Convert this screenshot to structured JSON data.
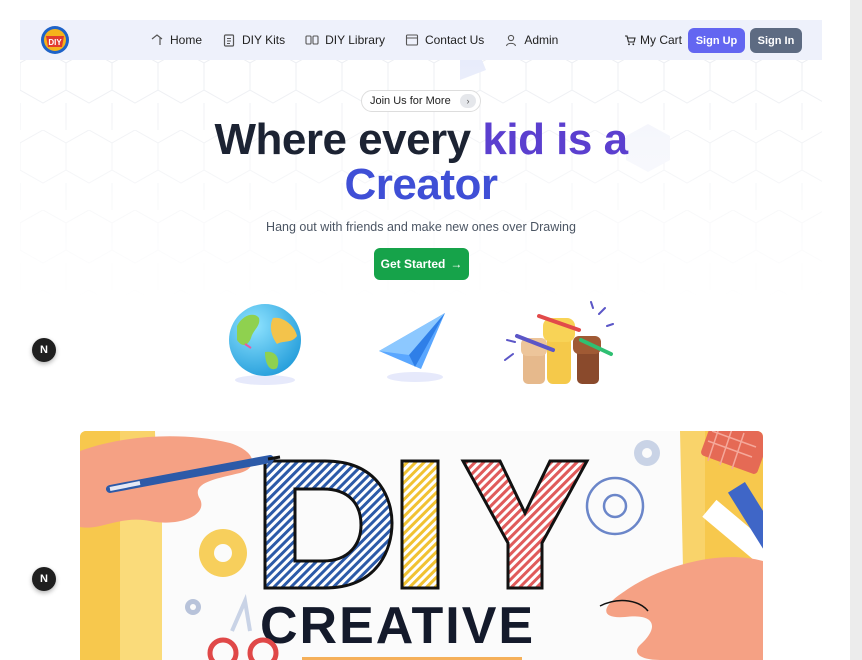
{
  "nav": {
    "logo_text": "DIY",
    "links": [
      {
        "label": "Home",
        "icon": "home-icon"
      },
      {
        "label": "DIY Kits",
        "icon": "clipboard-icon"
      },
      {
        "label": "DIY Library",
        "icon": "library-icon"
      },
      {
        "label": "Contact Us",
        "icon": "contact-icon"
      },
      {
        "label": "Admin",
        "icon": "user-icon"
      }
    ],
    "cart_label": "My Cart",
    "signup_label": "Sign Up",
    "signin_label": "Sign In"
  },
  "hero": {
    "pill_label": "Join Us for More",
    "headline_part1": "Where every ",
    "headline_accent": "kid is a",
    "headline_line2": "Creator",
    "subtitle": "Hang out with friends and make new ones over Drawing",
    "cta_label": "Get Started",
    "cta_arrow": "→"
  },
  "floating": {
    "badge_letter": "N"
  },
  "banner": {
    "title": "DIY",
    "subtitle": "CREATIVE"
  },
  "colors": {
    "nav_bg": "#eef1fb",
    "signup": "#6366f1",
    "signin": "#5d6b82",
    "cta": "#16a34a",
    "headline_dark": "#1c2333",
    "headline_purple": "#5b3fcf",
    "headline_blue": "#3f4fd6"
  }
}
